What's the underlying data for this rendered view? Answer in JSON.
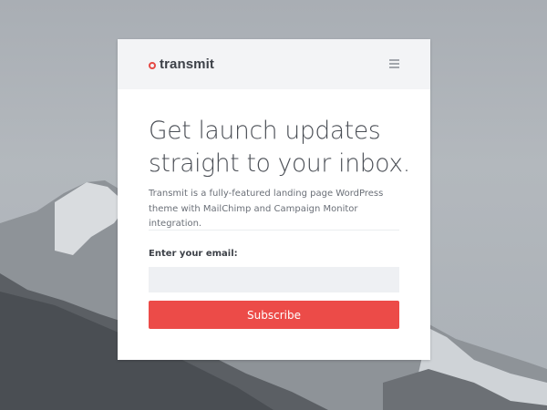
{
  "brand": {
    "name": "transmit",
    "accent_color": "#ec4b48"
  },
  "header": {
    "menu_icon": "hamburger-menu-icon"
  },
  "hero": {
    "headline": "Get launch updates straight to your inbox.",
    "description": "Transmit is a fully-featured landing page WordPress theme with MailChimp and Campaign Monitor integration."
  },
  "form": {
    "email_label": "Enter your email:",
    "email_value": "",
    "subscribe_label": "Subscribe"
  }
}
